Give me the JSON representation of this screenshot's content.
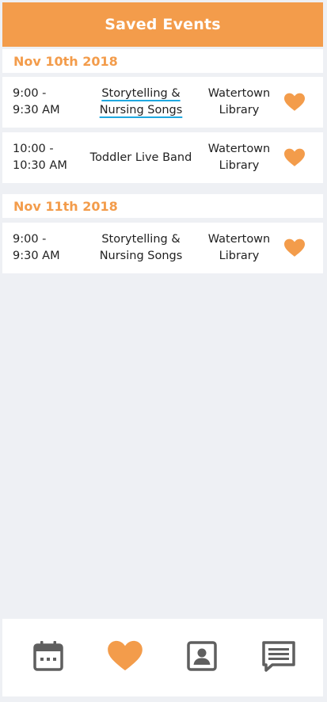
{
  "header": {
    "title": "Saved Events"
  },
  "groups": [
    {
      "date": "Nov 10th 2018",
      "events": [
        {
          "time": "9:00 -\n9:30 AM",
          "title": "Storytelling &\nNursing Songs",
          "location": "Watertown\nLibrary",
          "saved": true
        },
        {
          "time": "10:00 -\n10:30 AM",
          "title": "Toddler Live Band",
          "location": "Watertown\nLibrary",
          "saved": true
        }
      ]
    },
    {
      "date": "Nov 11th 2018",
      "events": [
        {
          "time": "9:00 -\n9:30 AM",
          "title": "Storytelling &\nNursing Songs",
          "location": "Watertown\nLibrary",
          "saved": true
        }
      ]
    }
  ],
  "bottom_nav": [
    {
      "icon": "calendar-icon",
      "active": false
    },
    {
      "icon": "heart-icon",
      "active": true
    },
    {
      "icon": "contact-card-icon",
      "active": false
    },
    {
      "icon": "chat-icon",
      "active": false
    }
  ],
  "colors": {
    "accent": "#f39c4b",
    "background": "#eef0f4",
    "icon_gray": "#5f5f5f",
    "spellcheck_underline": "#1fa8e0"
  }
}
